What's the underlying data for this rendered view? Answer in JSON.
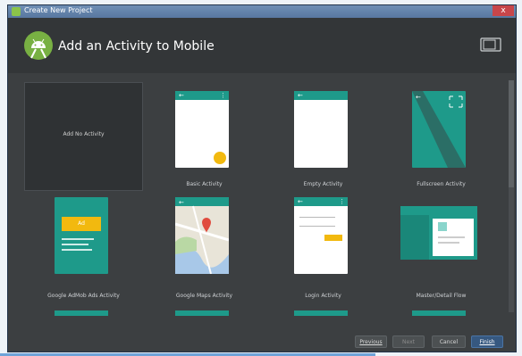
{
  "window": {
    "title": "Create New Project",
    "close_glyph": "x"
  },
  "header": {
    "title": "Add an Activity to Mobile",
    "logo": "android-studio-logo",
    "device_icon": "tablet-icon"
  },
  "activities": [
    {
      "label": "Add No Activity"
    },
    {
      "label": "Basic Activity"
    },
    {
      "label": "Empty Activity"
    },
    {
      "label": "Fullscreen Activity"
    },
    {
      "label": "Google AdMob Ads Activity"
    },
    {
      "label": "Google Maps Activity"
    },
    {
      "label": "Login Activity"
    },
    {
      "label": "Master/Detail Flow"
    }
  ],
  "ad_text": "Ad",
  "buttons": {
    "previous": "Previous",
    "next": "Next",
    "cancel": "Cancel",
    "finish": "Finish"
  },
  "colors": {
    "teal": "#1e9a8a",
    "accent": "#f2b90f",
    "dialog_bg": "#3c3f41",
    "header_bg": "#333638"
  }
}
